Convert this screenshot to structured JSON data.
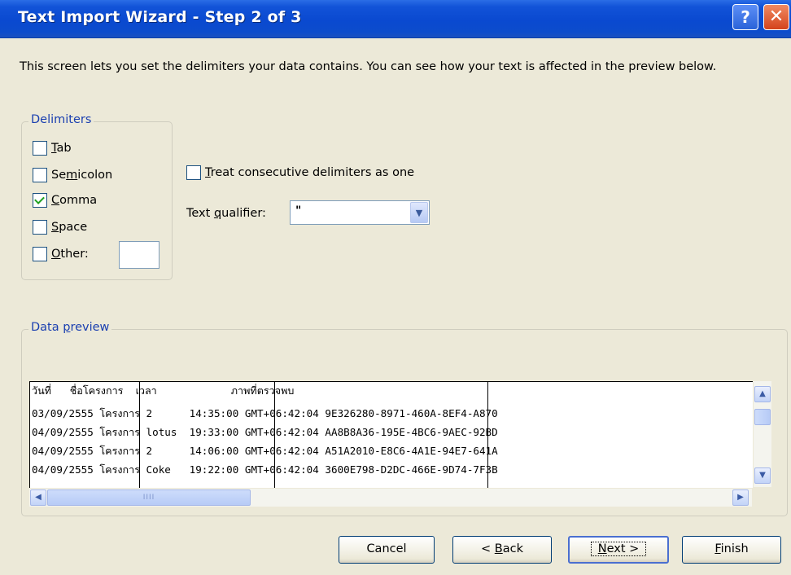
{
  "window": {
    "title": "Text Import Wizard - Step 2 of 3",
    "help_label": "?",
    "close_label": "✕"
  },
  "intro": "This screen lets you set the delimiters your data contains.  You can see how your text is affected in the preview below.",
  "delimiters": {
    "legend": "Delimiters",
    "tab": {
      "pre": "",
      "key": "T",
      "post": "ab",
      "checked": false
    },
    "semicolon": {
      "pre": "Se",
      "key": "m",
      "post": "icolon",
      "checked": false
    },
    "comma": {
      "pre": "",
      "key": "C",
      "post": "omma",
      "checked": true
    },
    "space": {
      "pre": "",
      "key": "S",
      "post": "pace",
      "checked": false
    },
    "other": {
      "pre": "",
      "key": "O",
      "post": "ther:",
      "checked": false,
      "value": ""
    }
  },
  "consecutive": {
    "pre": "",
    "key": "T",
    "post": "reat consecutive delimiters as one",
    "checked": false
  },
  "qualifier": {
    "pre": "Text ",
    "key": "q",
    "post": "ualifier:",
    "value": "\""
  },
  "preview": {
    "legend": "Data preview",
    "rows": [
      "วันที่   ชื่อโครงการ  เวลา            ภาพที่ตรวจพบ",
      "03/09/2555 โครงการ 2      14:35:00 GMT+06:42:04 9E326280-8971-460A-8EF4-A870",
      "04/09/2555 โครงการ lotus  19:33:00 GMT+06:42:04 AA8B8A36-195E-4BC6-9AEC-92BD",
      "04/09/2555 โครงการ 2      14:06:00 GMT+06:42:04 A51A2010-E8C6-4A1E-94E7-641A",
      "04/09/2555 โครงการ Coke   19:22:00 GMT+06:42:04 3600E798-D2DC-466E-9D74-7F3B"
    ],
    "hthumb_grip": "IIII"
  },
  "buttons": {
    "cancel": "Cancel",
    "back_pre": "< ",
    "back_key": "B",
    "back_post": "ack",
    "next_key": "N",
    "next_post": "ext >",
    "finish_key": "F",
    "finish_post": "inish"
  }
}
